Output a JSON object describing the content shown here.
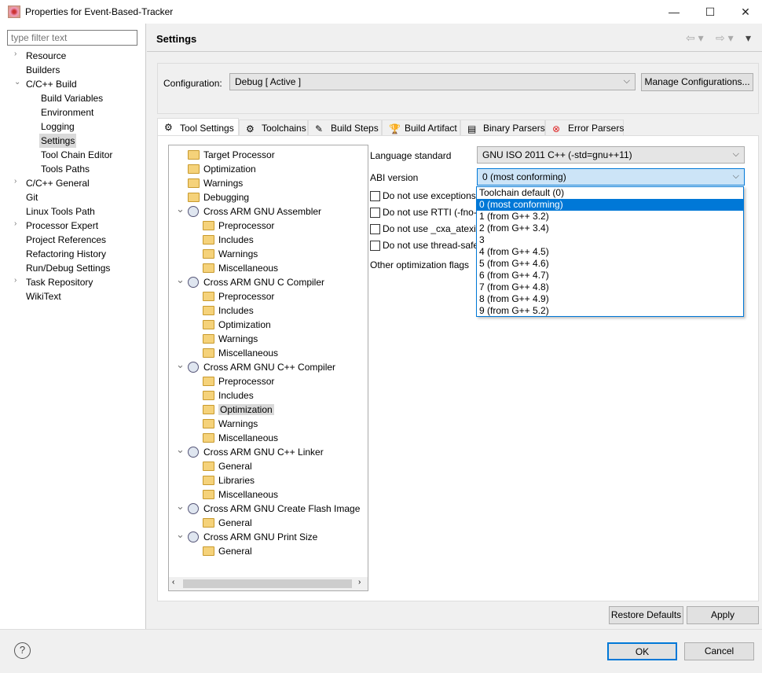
{
  "window": {
    "title": "Properties for Event-Based-Tracker",
    "minimize": "—",
    "maximize": "☐",
    "close": "✕"
  },
  "filter": {
    "placeholder": "type filter text"
  },
  "nav": [
    {
      "label": "Resource",
      "level": 0,
      "chev": "›"
    },
    {
      "label": "Builders",
      "level": 0,
      "chev": ""
    },
    {
      "label": "C/C++ Build",
      "level": 0,
      "chev": "⌄"
    },
    {
      "label": "Build Variables",
      "level": 1,
      "chev": ""
    },
    {
      "label": "Environment",
      "level": 1,
      "chev": ""
    },
    {
      "label": "Logging",
      "level": 1,
      "chev": ""
    },
    {
      "label": "Settings",
      "level": 1,
      "chev": "",
      "selected": true
    },
    {
      "label": "Tool Chain Editor",
      "level": 1,
      "chev": ""
    },
    {
      "label": "Tools Paths",
      "level": 1,
      "chev": ""
    },
    {
      "label": "C/C++ General",
      "level": 0,
      "chev": "›"
    },
    {
      "label": "Git",
      "level": 0,
      "chev": ""
    },
    {
      "label": "Linux Tools Path",
      "level": 0,
      "chev": ""
    },
    {
      "label": "Processor Expert",
      "level": 0,
      "chev": "›"
    },
    {
      "label": "Project References",
      "level": 0,
      "chev": ""
    },
    {
      "label": "Refactoring History",
      "level": 0,
      "chev": ""
    },
    {
      "label": "Run/Debug Settings",
      "level": 0,
      "chev": ""
    },
    {
      "label": "Task Repository",
      "level": 0,
      "chev": "›"
    },
    {
      "label": "WikiText",
      "level": 0,
      "chev": ""
    }
  ],
  "header": {
    "title": "Settings",
    "back": "⇦ ▾",
    "forward": "⇨ ▾",
    "menu": "▾"
  },
  "configuration": {
    "label": "Configuration:",
    "value": "Debug  [ Active ]",
    "manage": "Manage Configurations..."
  },
  "tabs": [
    {
      "label": "Tool Settings",
      "icon": "tool-icon",
      "glyph": "⚙",
      "active": true
    },
    {
      "label": "Toolchains",
      "icon": "toolchain-icon",
      "glyph": "⚙"
    },
    {
      "label": "Build Steps",
      "icon": "build-steps-icon",
      "glyph": "✎"
    },
    {
      "label": "Build Artifact",
      "icon": "trophy-icon",
      "glyph": "🏆"
    },
    {
      "label": "Binary Parsers",
      "icon": "binary-icon",
      "glyph": "▤"
    },
    {
      "label": "Error Parsers",
      "icon": "error-icon",
      "glyph": "⊗"
    }
  ],
  "tool_tree": [
    {
      "label": "Target Processor",
      "level": 1,
      "type": "folder"
    },
    {
      "label": "Optimization",
      "level": 1,
      "type": "folder"
    },
    {
      "label": "Warnings",
      "level": 1,
      "type": "folder"
    },
    {
      "label": "Debugging",
      "level": 1,
      "type": "folder"
    },
    {
      "label": "Cross ARM GNU Assembler",
      "level": 1,
      "type": "tool",
      "expanded": true
    },
    {
      "label": "Preprocessor",
      "level": 2,
      "type": "folder"
    },
    {
      "label": "Includes",
      "level": 2,
      "type": "folder"
    },
    {
      "label": "Warnings",
      "level": 2,
      "type": "folder"
    },
    {
      "label": "Miscellaneous",
      "level": 2,
      "type": "folder"
    },
    {
      "label": "Cross ARM GNU C Compiler",
      "level": 1,
      "type": "tool",
      "expanded": true
    },
    {
      "label": "Preprocessor",
      "level": 2,
      "type": "folder"
    },
    {
      "label": "Includes",
      "level": 2,
      "type": "folder"
    },
    {
      "label": "Optimization",
      "level": 2,
      "type": "folder"
    },
    {
      "label": "Warnings",
      "level": 2,
      "type": "folder"
    },
    {
      "label": "Miscellaneous",
      "level": 2,
      "type": "folder"
    },
    {
      "label": "Cross ARM GNU C++ Compiler",
      "level": 1,
      "type": "tool",
      "expanded": true
    },
    {
      "label": "Preprocessor",
      "level": 2,
      "type": "folder"
    },
    {
      "label": "Includes",
      "level": 2,
      "type": "folder"
    },
    {
      "label": "Optimization",
      "level": 2,
      "type": "folder",
      "selected": true
    },
    {
      "label": "Warnings",
      "level": 2,
      "type": "folder"
    },
    {
      "label": "Miscellaneous",
      "level": 2,
      "type": "folder"
    },
    {
      "label": "Cross ARM GNU C++ Linker",
      "level": 1,
      "type": "tool",
      "expanded": true
    },
    {
      "label": "General",
      "level": 2,
      "type": "folder"
    },
    {
      "label": "Libraries",
      "level": 2,
      "type": "folder"
    },
    {
      "label": "Miscellaneous",
      "level": 2,
      "type": "folder"
    },
    {
      "label": "Cross ARM GNU Create Flash Image",
      "level": 1,
      "type": "tool",
      "expanded": true
    },
    {
      "label": "General",
      "level": 2,
      "type": "folder"
    },
    {
      "label": "Cross ARM GNU Print Size",
      "level": 1,
      "type": "tool",
      "expanded": true
    },
    {
      "label": "General",
      "level": 2,
      "type": "folder"
    }
  ],
  "options": {
    "language_standard": {
      "label": "Language standard",
      "value": "GNU ISO 2011 C++ (-std=gnu++11)"
    },
    "abi_version": {
      "label": "ABI version",
      "value": "0 (most conforming)"
    },
    "checkboxes": [
      {
        "label": "Do not use exceptions",
        "checked": false
      },
      {
        "label": "Do not use RTTI (-fno-r",
        "checked": false
      },
      {
        "label": "Do not use _cxa_atexit(",
        "checked": false
      },
      {
        "label": "Do not use thread-safe",
        "checked": false
      }
    ],
    "other_flags": {
      "label": "Other optimization flags"
    }
  },
  "abi_dropdown": {
    "selected_index": 1,
    "options": [
      "Toolchain default (0)",
      "0 (most conforming)",
      "1 (from G++ 3.2)",
      "2 (from G++ 3.4)",
      "3",
      "4 (from G++ 4.5)",
      "5 (from G++ 4.6)",
      "6 (from G++ 4.7)",
      "7 (from G++ 4.8)",
      "8 (from G++ 4.9)",
      "9 (from G++ 5.2)"
    ]
  },
  "buttons": {
    "restore": "Restore Defaults",
    "apply": "Apply",
    "ok": "OK",
    "cancel": "Cancel",
    "help": "?"
  },
  "colors": {
    "accent": "#0078d7",
    "selection_bg": "#cce4f7"
  }
}
